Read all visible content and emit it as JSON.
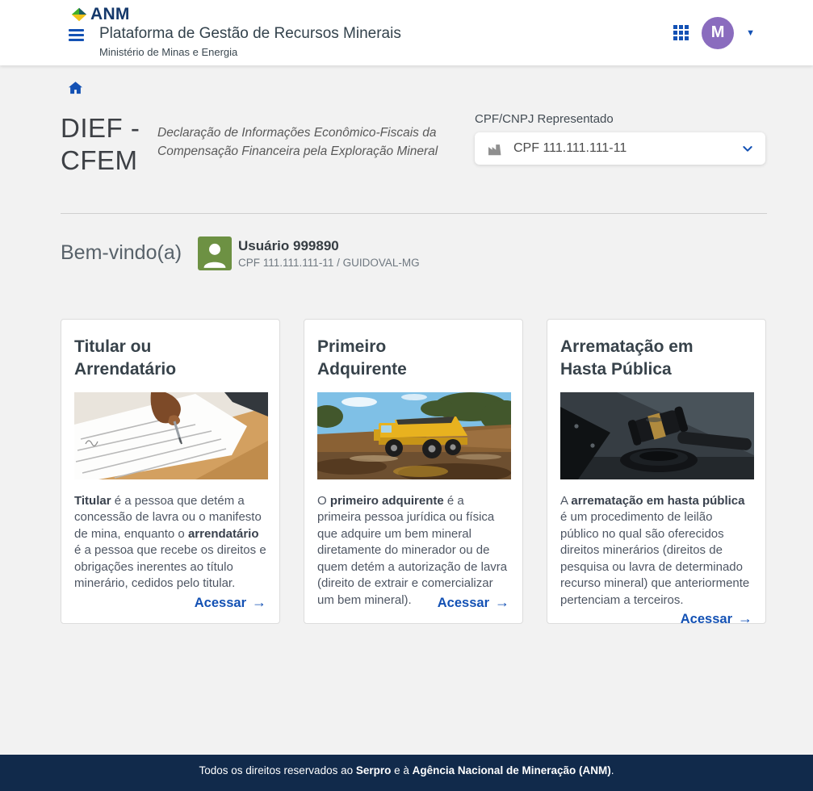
{
  "header": {
    "logo_text": "ANM",
    "title": "Plataforma de Gestão de Recursos Minerais",
    "subtitle": "Ministério de Minas e Energia",
    "avatar_initial": "M"
  },
  "icons": {
    "caret_down": "▼",
    "arrow_right": "→"
  },
  "colors": {
    "accent_blue": "#1351b4",
    "logo_navy": "#14386b",
    "avatar_purple": "#8a6cbe",
    "user_green": "#6d9143",
    "footer_navy": "#112a4b"
  },
  "page": {
    "title": "DIEF - CFEM",
    "description": "Declaração de Informações Econômico-Fiscais da Compensação Financeira pela Exploração Mineral",
    "cpf_label": "CPF/CNPJ Representado",
    "cpf_value": "CPF 111.111.111-11"
  },
  "welcome": {
    "greeting": "Bem-vindo(a)",
    "user_name": "Usuário 999890",
    "user_detail": "CPF 111.111.111-11 / GUIDOVAL-MG"
  },
  "cards": [
    {
      "title": "Titular ou Arrendatário",
      "image_name": "hand-signing-document",
      "link_label": "Acessar",
      "body_segments": [
        {
          "text": "Titular",
          "bold": true
        },
        {
          "text": " é a pessoa que detém a concessão de lavra ou o manifesto de mina, enquanto o "
        },
        {
          "text": "arrendatário",
          "bold": true
        },
        {
          "text": " é a pessoa que recebe os direitos e obrigações inerentes ao título minerário, cedidos pelo titular."
        }
      ]
    },
    {
      "title": "Primeiro Adquirente",
      "image_name": "yellow-dump-truck",
      "link_label": "Acessar",
      "body_segments": [
        {
          "text": "O "
        },
        {
          "text": "primeiro adquirente",
          "bold": true
        },
        {
          "text": " é a primeira pessoa jurídica ou física que adquire um bem mineral diretamente do minerador ou de quem detém a autorização de lavra (direito de extrair e comercializar um bem mineral)."
        }
      ]
    },
    {
      "title": "Arrematação em Hasta Pública",
      "image_name": "auction-gavel",
      "link_label": "Acessar",
      "body_segments": [
        {
          "text": "A "
        },
        {
          "text": "arrematação em hasta pública",
          "bold": true
        },
        {
          "text": " é um procedimento de leilão público no qual são oferecidos direitos minerários (direitos de pesquisa ou lavra de determinado recurso mineral) que anteriormente pertenciam a terceiros."
        }
      ]
    }
  ],
  "footer": {
    "segments": [
      {
        "text": "Todos os direitos reservados ao "
      },
      {
        "text": "Serpro",
        "bold": true
      },
      {
        "text": " e à "
      },
      {
        "text": "Agência Nacional de Mineração (ANM)",
        "bold": true
      },
      {
        "text": "."
      }
    ]
  }
}
